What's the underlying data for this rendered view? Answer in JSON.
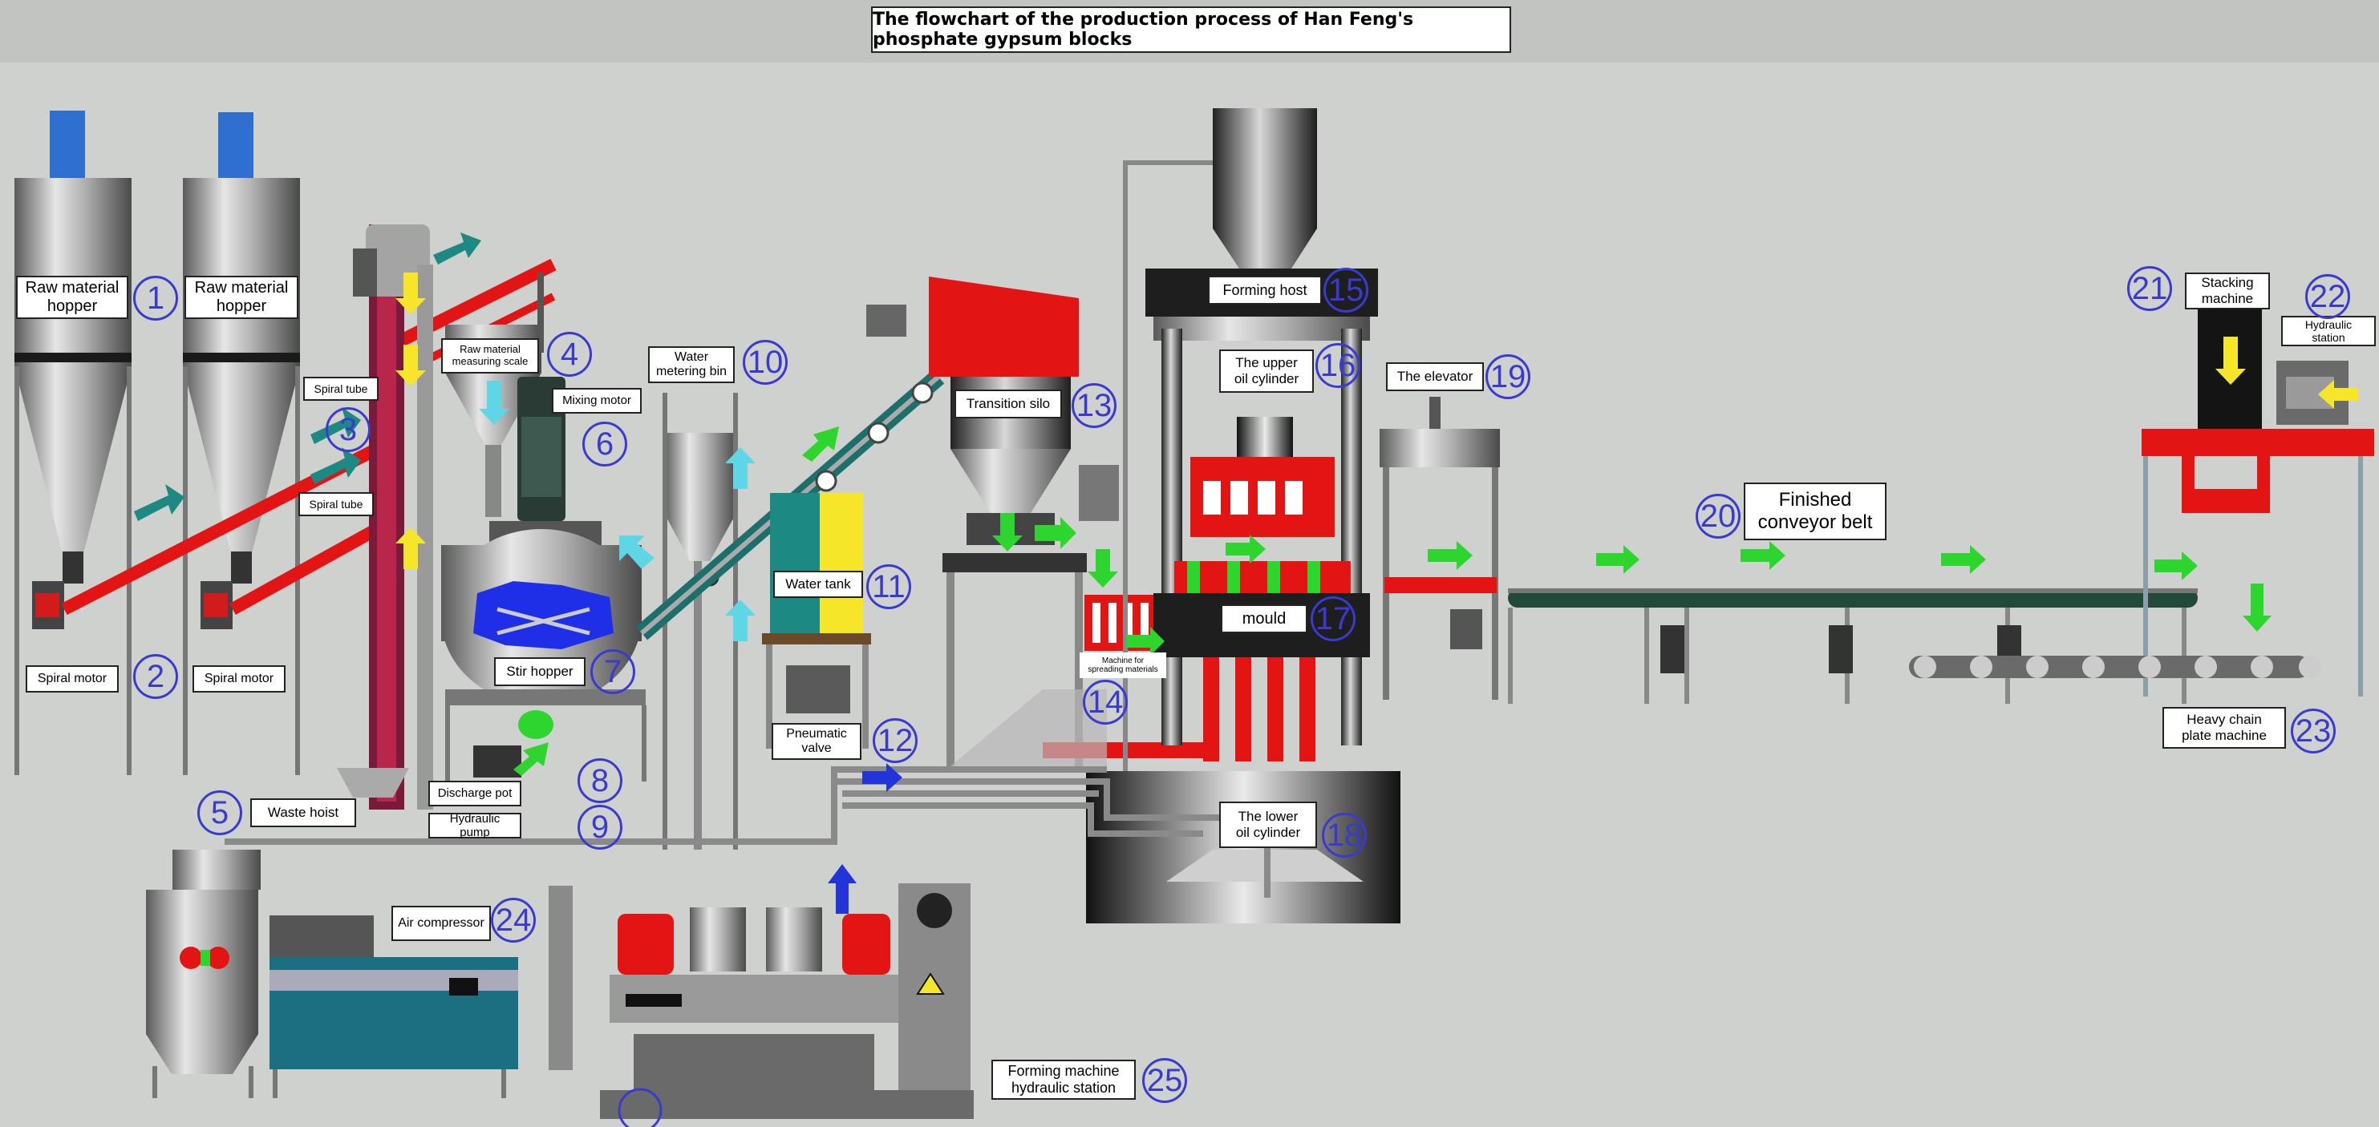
{
  "title": "The flowchart of the production process of Han Feng's phosphate gypsum blocks",
  "colors": {
    "background": "#cfd1cf",
    "number_circle": "#3a3ad0",
    "flow_arrow_green": "#2fd52f",
    "flow_arrow_yellow": "#f5e62a",
    "flow_arrow_teal": "#1c8a82",
    "flow_arrow_cyan": "#5fd6e6",
    "flow_arrow_blue": "#2235d8",
    "equipment_red": "#e31414",
    "equipment_grey": "#8c8c8c"
  },
  "components": [
    {
      "number": "1",
      "label": "Raw material\nhopper"
    },
    {
      "number": "",
      "label": "Raw material\nhopper"
    },
    {
      "number": "2",
      "label": "Spiral motor"
    },
    {
      "number": "",
      "label": "Spiral motor"
    },
    {
      "number": "3",
      "label": "Spiral tube"
    },
    {
      "number": "",
      "label": "Spiral tube"
    },
    {
      "number": "4",
      "label": "Raw material\nmeasuring scale"
    },
    {
      "number": "5",
      "label": "Waste hoist"
    },
    {
      "number": "6",
      "label": "Mixing motor"
    },
    {
      "number": "7",
      "label": "Stir hopper"
    },
    {
      "number": "8",
      "label": "Discharge pot"
    },
    {
      "number": "9",
      "label": "Hydraulic pump"
    },
    {
      "number": "10",
      "label": "Water\nmetering bin"
    },
    {
      "number": "11",
      "label": "Water tank"
    },
    {
      "number": "12",
      "label": "Pneumatic\nvalve"
    },
    {
      "number": "13",
      "label": "Transition silo"
    },
    {
      "number": "14",
      "label": "Machine for\nspreading materials"
    },
    {
      "number": "15",
      "label": "Forming host"
    },
    {
      "number": "16",
      "label": "The upper\noil cylinder"
    },
    {
      "number": "17",
      "label": "mould"
    },
    {
      "number": "18",
      "label": "The lower\noil cylinder"
    },
    {
      "number": "19",
      "label": "The elevator"
    },
    {
      "number": "20",
      "label": "Finished\nconveyor belt"
    },
    {
      "number": "21",
      "label": "Stacking\nmachine"
    },
    {
      "number": "22",
      "label": "Hydraulic station"
    },
    {
      "number": "23",
      "label": "Heavy chain\nplate machine"
    },
    {
      "number": "24",
      "label": "Air compressor"
    },
    {
      "number": "25",
      "label": "Forming machine\nhydraulic station"
    }
  ]
}
